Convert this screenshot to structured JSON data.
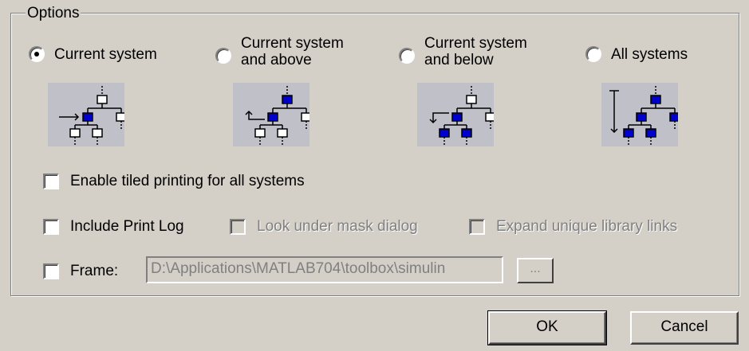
{
  "options": {
    "group_title": "Options",
    "radios": [
      {
        "label": "Current system",
        "checked": true,
        "icon": "hierarchy-current-icon"
      },
      {
        "label": "Current system\nand above",
        "checked": false,
        "icon": "hierarchy-above-icon"
      },
      {
        "label": "Current system\nand below",
        "checked": false,
        "icon": "hierarchy-below-icon"
      },
      {
        "label": "All systems",
        "checked": false,
        "icon": "hierarchy-all-icon"
      }
    ],
    "tiled_printing": {
      "label": "Enable tiled printing for all systems",
      "checked": false
    },
    "print_log": {
      "label": "Include Print Log",
      "checked": false
    },
    "look_under_mask": {
      "label": "Look under mask dialog",
      "checked": false,
      "enabled": false
    },
    "expand_library_links": {
      "label": "Expand unique library links",
      "checked": false,
      "enabled": false
    },
    "frame": {
      "label": "Frame:",
      "checked": false,
      "path_value": "D:\\Applications\\MATLAB704\\toolbox\\simulin",
      "browse_label": "..."
    }
  },
  "buttons": {
    "ok_label": "OK",
    "cancel_label": "Cancel"
  },
  "colors": {
    "dialog_bg": "#d4d0c8",
    "icon_bg": "#c0c0c8",
    "highlight_block": "#0000cc"
  }
}
